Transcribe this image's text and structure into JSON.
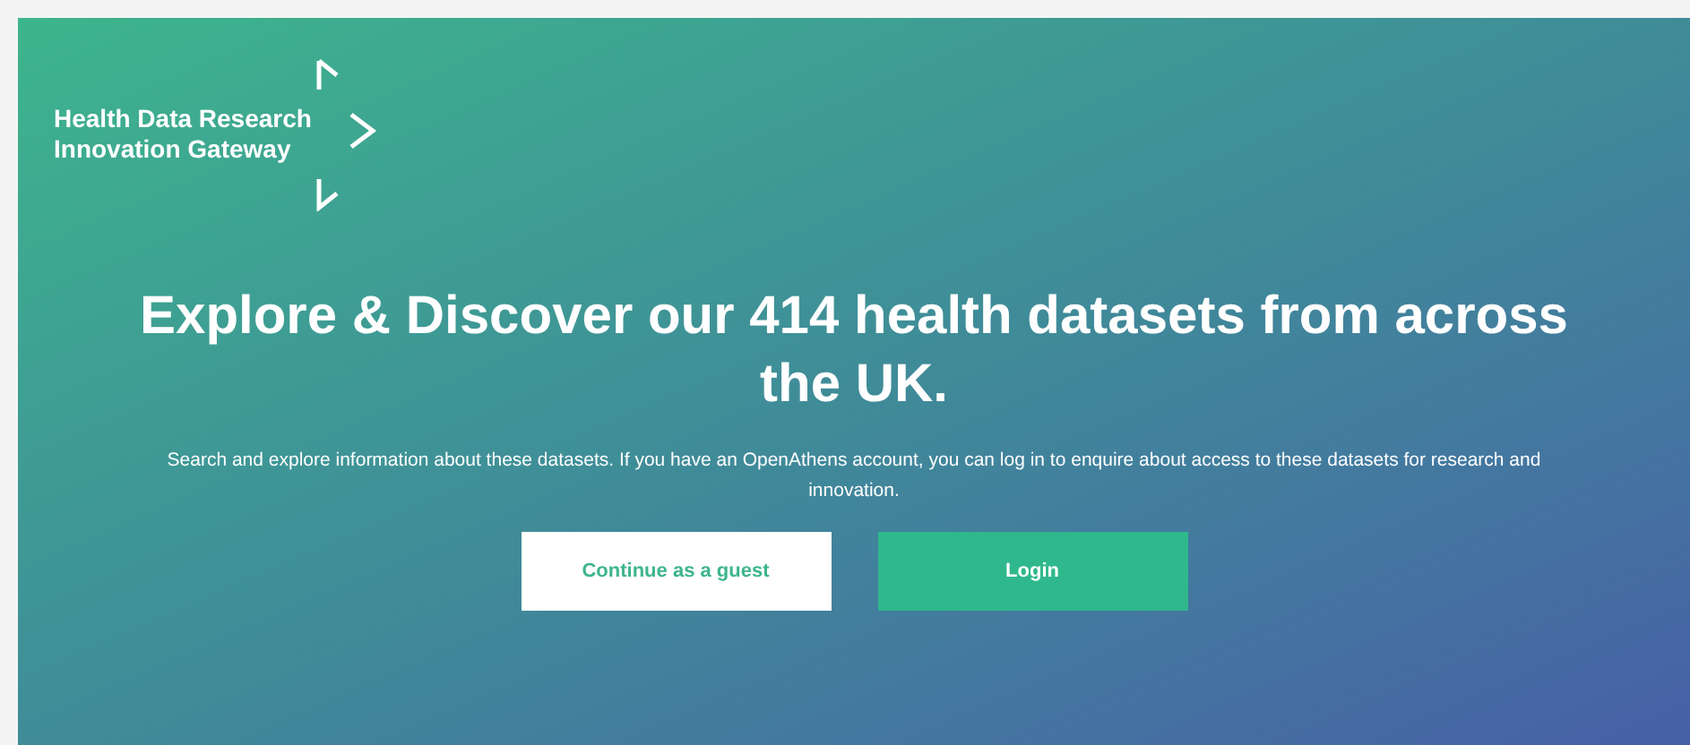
{
  "logo": {
    "lines": [
      "Health Data Research",
      "Innovation Gateway"
    ]
  },
  "headline": "Explore & Discover our 414 health datasets from across the UK.",
  "subtitle": "Search and explore information about these datasets. If you have an OpenAthens account, you can log in to enquire about access to these datasets for research and innovation.",
  "buttons": [
    {
      "label": "Continue as a guest",
      "kind": "secondary"
    },
    {
      "label": "Login",
      "kind": "primary"
    }
  ]
}
